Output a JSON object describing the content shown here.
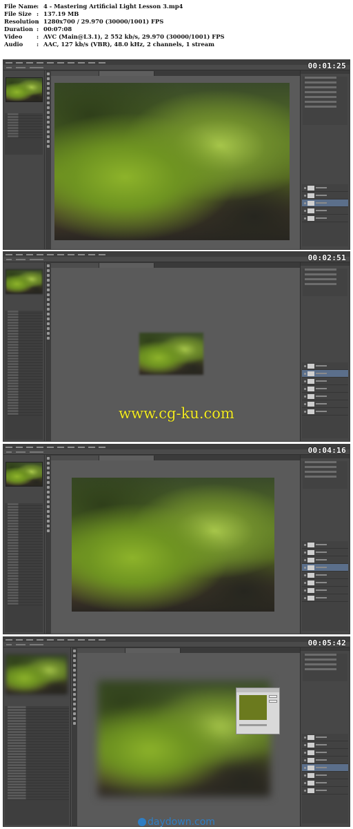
{
  "file_info": {
    "rows": [
      {
        "key": "File Name",
        "value": "4 - Mastering Artificial Light Lesson 3.mp4"
      },
      {
        "key": "File Size",
        "value": "137.19 MB"
      },
      {
        "key": "Resolution",
        "value": "1280x700 / 29.970 (30000/1001) FPS"
      },
      {
        "key": "Duration",
        "value": "00:07:08"
      },
      {
        "key": "Video",
        "value": "AVC (Main@L3.1), 2 552 kb/s, 29.970 (30000/1001) FPS"
      },
      {
        "key": "Audio",
        "value": "AAC, 127 kb/s (VBR), 48.0 kHz, 2 channels, 1 stream"
      }
    ],
    "separator": ":"
  },
  "frames": [
    {
      "timestamp": "00:01:25"
    },
    {
      "timestamp": "00:02:51"
    },
    {
      "timestamp": "00:04:16"
    },
    {
      "timestamp": "00:05:42"
    }
  ],
  "watermark": "www.cg-ku.com",
  "bottom_logo": "daydown.com",
  "colors": {
    "watermark": "#f2ea23",
    "logo": "#2f7ec4",
    "ui_bg": "#535353"
  }
}
